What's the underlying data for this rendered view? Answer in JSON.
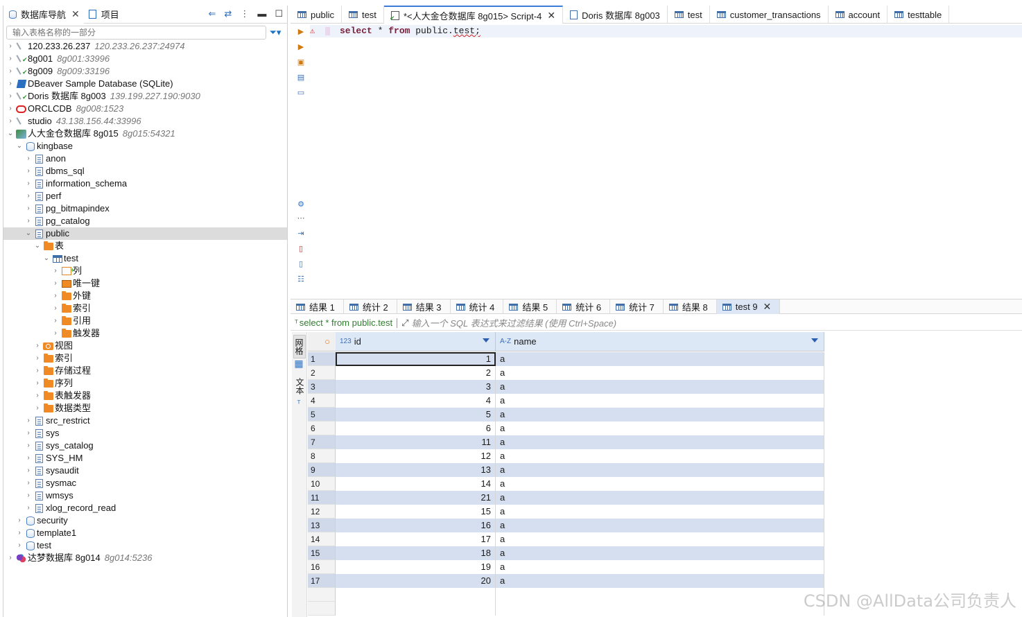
{
  "navigator": {
    "tab_label": "数据库导航",
    "project_tab_label": "项目",
    "filter_placeholder": "输入表格名称的一部分"
  },
  "tree": [
    {
      "name": "120.233.26.237",
      "sub": "120.233.26.237:24974",
      "icon": "connection-icon",
      "level": 0,
      "chevron": "›"
    },
    {
      "name": "8g001",
      "sub": "8g001:33996",
      "icon": "connection-ok-icon",
      "level": 0,
      "chevron": "›"
    },
    {
      "name": "8g009",
      "sub": "8g009:33196",
      "icon": "connection-ok-icon",
      "level": 0,
      "chevron": "›"
    },
    {
      "name": "DBeaver Sample Database (SQLite)",
      "sub": "",
      "icon": "sqlite-icon",
      "level": 0,
      "chevron": "›"
    },
    {
      "name": "Doris 数据库 8g003",
      "sub": "139.199.227.190:9030",
      "icon": "connection-ok-icon",
      "level": 0,
      "chevron": "›"
    },
    {
      "name": "ORCLCDB",
      "sub": "8g008:1523",
      "icon": "oracle-icon",
      "level": 0,
      "chevron": "›"
    },
    {
      "name": "studio",
      "sub": "43.138.156.44:33996",
      "icon": "connection-icon",
      "level": 0,
      "chevron": "›"
    },
    {
      "name": "人大金仓数据库 8g015",
      "sub": "8g015:54321",
      "icon": "kingbase-icon",
      "level": 0,
      "chevron": "⌄"
    },
    {
      "name": "kingbase",
      "sub": "",
      "icon": "database-icon",
      "level": 1,
      "chevron": "⌄"
    },
    {
      "name": "anon",
      "sub": "",
      "icon": "schema-icon",
      "level": 2,
      "chevron": "›"
    },
    {
      "name": "dbms_sql",
      "sub": "",
      "icon": "schema-icon",
      "level": 2,
      "chevron": "›"
    },
    {
      "name": "information_schema",
      "sub": "",
      "icon": "schema-icon",
      "level": 2,
      "chevron": "›"
    },
    {
      "name": "perf",
      "sub": "",
      "icon": "schema-icon",
      "level": 2,
      "chevron": "›"
    },
    {
      "name": "pg_bitmapindex",
      "sub": "",
      "icon": "schema-icon",
      "level": 2,
      "chevron": "›"
    },
    {
      "name": "pg_catalog",
      "sub": "",
      "icon": "schema-icon",
      "level": 2,
      "chevron": "›"
    },
    {
      "name": "public",
      "sub": "",
      "icon": "schema-icon",
      "level": 2,
      "chevron": "⌄",
      "selected": true
    },
    {
      "name": "表",
      "sub": "",
      "icon": "tables-folder-icon",
      "level": 3,
      "chevron": "⌄"
    },
    {
      "name": "test",
      "sub": "",
      "icon": "table-icon",
      "level": 4,
      "chevron": "⌄"
    },
    {
      "name": "列",
      "sub": "",
      "icon": "columns-icon",
      "level": 5,
      "chevron": "›"
    },
    {
      "name": "唯一键",
      "sub": "",
      "icon": "key-icon",
      "level": 5,
      "chevron": "›"
    },
    {
      "name": "外键",
      "sub": "",
      "icon": "folder-icon",
      "level": 5,
      "chevron": "›"
    },
    {
      "name": "索引",
      "sub": "",
      "icon": "folder-icon",
      "level": 5,
      "chevron": "›"
    },
    {
      "name": "引用",
      "sub": "",
      "icon": "folder-icon",
      "level": 5,
      "chevron": "›"
    },
    {
      "name": "触发器",
      "sub": "",
      "icon": "folder-icon",
      "level": 5,
      "chevron": "›"
    },
    {
      "name": "视图",
      "sub": "",
      "icon": "view-icon",
      "level": 3,
      "chevron": "›"
    },
    {
      "name": "索引",
      "sub": "",
      "icon": "folder-icon",
      "level": 3,
      "chevron": "›"
    },
    {
      "name": "存储过程",
      "sub": "",
      "icon": "folder-icon",
      "level": 3,
      "chevron": "›"
    },
    {
      "name": "序列",
      "sub": "",
      "icon": "folder-icon",
      "level": 3,
      "chevron": "›"
    },
    {
      "name": "表触发器",
      "sub": "",
      "icon": "folder-icon",
      "level": 3,
      "chevron": "›"
    },
    {
      "name": "数据类型",
      "sub": "",
      "icon": "folder-icon",
      "level": 3,
      "chevron": "›"
    },
    {
      "name": "src_restrict",
      "sub": "",
      "icon": "schema-icon",
      "level": 2,
      "chevron": "›"
    },
    {
      "name": "sys",
      "sub": "",
      "icon": "schema-icon",
      "level": 2,
      "chevron": "›"
    },
    {
      "name": "sys_catalog",
      "sub": "",
      "icon": "schema-icon",
      "level": 2,
      "chevron": "›"
    },
    {
      "name": "SYS_HM",
      "sub": "",
      "icon": "schema-icon",
      "level": 2,
      "chevron": "›"
    },
    {
      "name": "sysaudit",
      "sub": "",
      "icon": "schema-icon",
      "level": 2,
      "chevron": "›"
    },
    {
      "name": "sysmac",
      "sub": "",
      "icon": "schema-icon",
      "level": 2,
      "chevron": "›"
    },
    {
      "name": "wmsys",
      "sub": "",
      "icon": "schema-icon",
      "level": 2,
      "chevron": "›"
    },
    {
      "name": "xlog_record_read",
      "sub": "",
      "icon": "schema-icon",
      "level": 2,
      "chevron": "›"
    },
    {
      "name": "security",
      "sub": "",
      "icon": "database-icon",
      "level": 1,
      "chevron": "›"
    },
    {
      "name": "template1",
      "sub": "",
      "icon": "database-icon",
      "level": 1,
      "chevron": "›"
    },
    {
      "name": "test",
      "sub": "",
      "icon": "database-icon",
      "level": 1,
      "chevron": "›"
    },
    {
      "name": "达梦数据库 8g014",
      "sub": "8g014:5236",
      "icon": "dameng-icon",
      "level": 0,
      "chevron": "›"
    }
  ],
  "editor_tabs": [
    {
      "label": "public",
      "icon": "table-icon",
      "active": false
    },
    {
      "label": "test",
      "icon": "table-icon",
      "active": false
    },
    {
      "label": "*<人大金仓数据库 8g015> Script-4",
      "icon": "script-icon",
      "active": true
    },
    {
      "label": "Doris 数据库 8g003",
      "icon": "doc-icon",
      "active": false
    },
    {
      "label": "test",
      "icon": "table-icon",
      "active": false
    },
    {
      "label": "customer_transactions",
      "icon": "table-icon",
      "active": false
    },
    {
      "label": "account",
      "icon": "table-icon",
      "active": false
    },
    {
      "label": "testtable",
      "icon": "table-icon",
      "active": false
    }
  ],
  "editor": {
    "kw_select": "select",
    "star": " * ",
    "kw_from": "from",
    "schema": " public.",
    "table": "test;"
  },
  "result_tabs": [
    {
      "label": "结果 1",
      "active": false
    },
    {
      "label": "统计 2",
      "active": false
    },
    {
      "label": "结果 3",
      "active": false
    },
    {
      "label": "统计 4",
      "active": false
    },
    {
      "label": "结果 5",
      "active": false
    },
    {
      "label": "统计 6",
      "active": false
    },
    {
      "label": "统计 7",
      "active": false
    },
    {
      "label": "结果 8",
      "active": false
    },
    {
      "label": "test 9",
      "active": true
    }
  ],
  "filter_bar": {
    "query": "select * from public.test",
    "hint": "输入一个 SQL 表达式来过滤结果 (使用 Ctrl+Space)"
  },
  "side_tabs": {
    "grid": "网格",
    "text": "文本"
  },
  "grid": {
    "columns": [
      {
        "name": "id",
        "type": "123"
      },
      {
        "name": "name",
        "type": "A-Z"
      }
    ],
    "rows": [
      [
        "1",
        "1",
        "a"
      ],
      [
        "2",
        "2",
        "a"
      ],
      [
        "3",
        "3",
        "a"
      ],
      [
        "4",
        "4",
        "a"
      ],
      [
        "5",
        "5",
        "a"
      ],
      [
        "6",
        "6",
        "a"
      ],
      [
        "7",
        "11",
        "a"
      ],
      [
        "8",
        "12",
        "a"
      ],
      [
        "9",
        "13",
        "a"
      ],
      [
        "10",
        "14",
        "a"
      ],
      [
        "11",
        "21",
        "a"
      ],
      [
        "12",
        "15",
        "a"
      ],
      [
        "13",
        "16",
        "a"
      ],
      [
        "14",
        "17",
        "a"
      ],
      [
        "15",
        "18",
        "a"
      ],
      [
        "16",
        "19",
        "a"
      ],
      [
        "17",
        "20",
        "a"
      ]
    ]
  },
  "watermark": "CSDN @AllData公司负责人"
}
